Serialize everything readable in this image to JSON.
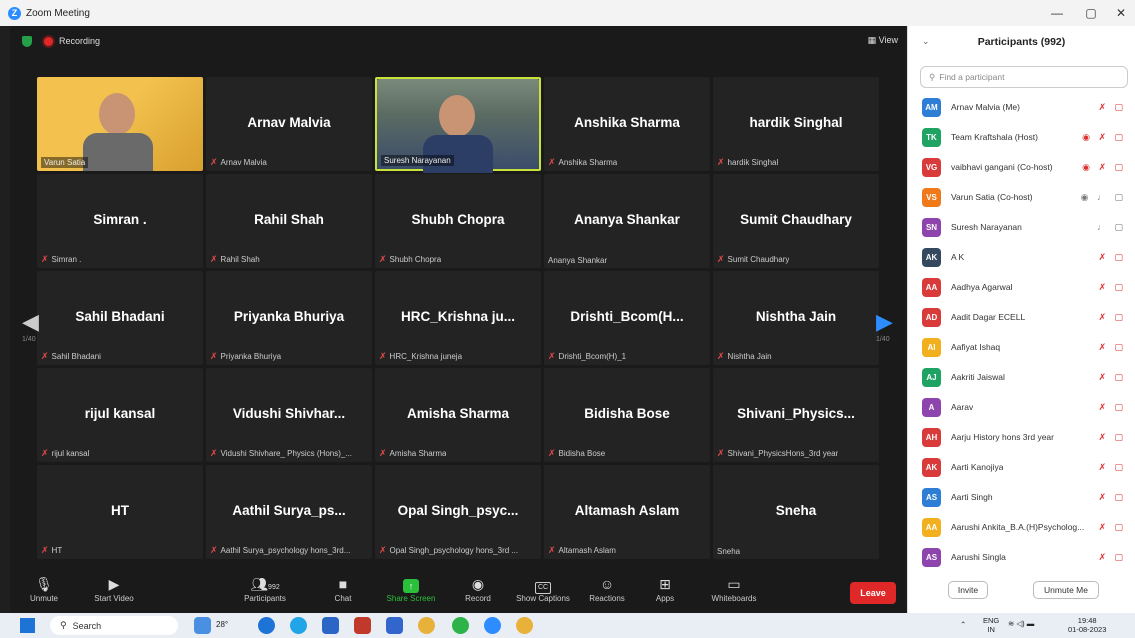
{
  "window": {
    "title": "Zoom Meeting",
    "minimize": "—",
    "restore": "▢",
    "close": "✕"
  },
  "meeting": {
    "recording_label": "Recording",
    "view_label": "View",
    "page_left": "1/40",
    "page_right": "1/40",
    "tiles": [
      [
        {
          "name": "",
          "label": "Varun Satia",
          "video": true,
          "muted": false
        },
        {
          "name": "Arnav Malvia",
          "label": "Arnav Malvia",
          "muted": true
        },
        {
          "name": "",
          "label": "Suresh Narayanan",
          "video": true,
          "muted": false,
          "active": true
        },
        {
          "name": "Anshika Sharma",
          "label": "Anshika Sharma",
          "muted": true
        },
        {
          "name": "hardik Singhal",
          "label": "hardik Singhal",
          "muted": true
        }
      ],
      [
        {
          "name": "Simran .",
          "label": "Simran .",
          "muted": true
        },
        {
          "name": "Rahil Shah",
          "label": "Rahil Shah",
          "muted": true
        },
        {
          "name": "Shubh Chopra",
          "label": "Shubh Chopra",
          "muted": true
        },
        {
          "name": "Ananya Shankar",
          "label": "Ananya Shankar",
          "muted": false
        },
        {
          "name": "Sumit Chaudhary",
          "label": "Sumit Chaudhary",
          "muted": true
        }
      ],
      [
        {
          "name": "Sahil Bhadani",
          "label": "Sahil Bhadani",
          "muted": true
        },
        {
          "name": "Priyanka Bhuriya",
          "label": "Priyanka Bhuriya",
          "muted": true
        },
        {
          "name": "HRC_Krishna ju...",
          "label": "HRC_Krishna juneja",
          "muted": true
        },
        {
          "name": "Drishti_Bcom(H...",
          "label": "Drishti_Bcom(H)_1",
          "muted": true
        },
        {
          "name": "Nishtha Jain",
          "label": "Nishtha Jain",
          "muted": true
        }
      ],
      [
        {
          "name": "rijul kansal",
          "label": "rijul kansal",
          "muted": true
        },
        {
          "name": "Vidushi Shivhar...",
          "label": "Vidushi Shivhare_ Physics (Hons)_...",
          "muted": true
        },
        {
          "name": "Amisha Sharma",
          "label": "Amisha Sharma",
          "muted": true
        },
        {
          "name": "Bidisha Bose",
          "label": "Bidisha Bose",
          "muted": true
        },
        {
          "name": "Shivani_Physics...",
          "label": "Shivani_PhysicsHons_3rd year",
          "muted": true
        }
      ],
      [
        {
          "name": "HT",
          "label": "HT",
          "muted": true
        },
        {
          "name": "Aathil Surya_ps...",
          "label": "Aathil Surya_psychology hons_3rd...",
          "muted": true
        },
        {
          "name": "Opal Singh_psyc...",
          "label": "Opal Singh_psychology hons_3rd ...",
          "muted": true
        },
        {
          "name": "Altamash Aslam",
          "label": "Altamash Aslam",
          "muted": true
        },
        {
          "name": "Sneha",
          "label": "Sneha",
          "muted": false
        }
      ]
    ]
  },
  "toolbar": {
    "unmute": "Unmute",
    "start_video": "Start Video",
    "participants": "Participants",
    "participants_count": "992",
    "chat": "Chat",
    "share_screen": "Share Screen",
    "record": "Record",
    "show_captions": "Show Captions",
    "reactions": "Reactions",
    "apps": "Apps",
    "whiteboards": "Whiteboards",
    "leave": "Leave",
    "share_color": "#2bc03b",
    "leave_color": "#e02828"
  },
  "participants_panel": {
    "title": "Participants (992)",
    "search_placeholder": "Find a participant",
    "invite": "Invite",
    "unmute_me": "Unmute Me",
    "list": [
      {
        "initials": "AM",
        "name": "Arnav Malvia (Me)",
        "color": "#2d7ed4",
        "icons": "✗ ▢"
      },
      {
        "initials": "TK",
        "name": "Team Kraftshala (Host)",
        "color": "#1ea362",
        "icons": "◉ ✗ ▢"
      },
      {
        "initials": "VG",
        "name": "vaibhavi gangani (Co-host)",
        "color": "#d93b3b",
        "icons": "◉ ✗ ▢"
      },
      {
        "initials": "VS",
        "name": "Varun Satia (Co-host)",
        "color": "#f07a1a",
        "icons": "◉ ♩ ▢",
        "gray": true
      },
      {
        "initials": "SN",
        "name": "Suresh Narayanan",
        "color": "#8e44ad",
        "icons": "♩ ▢",
        "gray": true
      },
      {
        "initials": "AK",
        "name": "A K",
        "color": "#34495e",
        "icons": "✗ ▢"
      },
      {
        "initials": "AA",
        "name": "Aadhya Agarwal",
        "color": "#d93b3b",
        "icons": "✗ ▢"
      },
      {
        "initials": "AD",
        "name": "Aadit Dagar ECELL",
        "color": "#d93b3b",
        "icons": "✗ ▢"
      },
      {
        "initials": "AI",
        "name": "Aafiyat Ishaq",
        "color": "#f2b01e",
        "icons": "✗ ▢"
      },
      {
        "initials": "AJ",
        "name": "Aakriti Jaiswal",
        "color": "#1ea362",
        "icons": "✗ ▢"
      },
      {
        "initials": "A",
        "name": "Aarav",
        "color": "#8e44ad",
        "icons": "✗ ▢"
      },
      {
        "initials": "AH",
        "name": "Aarju History hons 3rd year",
        "color": "#d93b3b",
        "icons": "✗ ▢"
      },
      {
        "initials": "AK",
        "name": "Aarti Kanojiya",
        "color": "#d93b3b",
        "icons": "✗ ▢"
      },
      {
        "initials": "AS",
        "name": "Aarti Singh",
        "color": "#2d7ed4",
        "icons": "✗ ▢"
      },
      {
        "initials": "AA",
        "name": "Aarushi Ankita_B.A.(H)Psycholog...",
        "color": "#f2b01e",
        "icons": "✗ ▢"
      },
      {
        "initials": "AS",
        "name": "Aarushi Singla",
        "color": "#8e44ad",
        "icons": "✗ ▢"
      }
    ]
  },
  "taskbar": {
    "search": "Search",
    "temp": "28°",
    "lang": "ENG",
    "lang2": "IN",
    "time": "19:48",
    "date": "01-08-2023"
  }
}
